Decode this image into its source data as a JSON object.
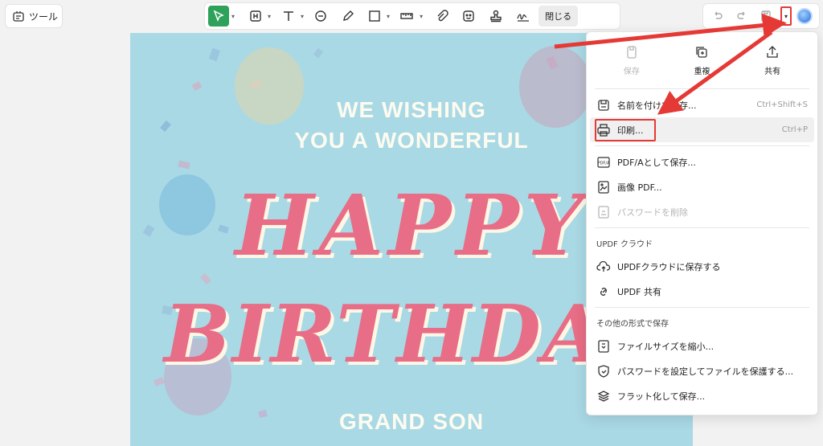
{
  "left": {
    "tools_label": "ツール"
  },
  "toolbar": {
    "close_label": "閉じる"
  },
  "document": {
    "line1": "WE WISHING",
    "line2": "YOU A WONDERFUL",
    "line3": "HAPPY",
    "line4": "BIRTHDAY",
    "line5": "GRAND SON"
  },
  "menu": {
    "top": [
      {
        "label": "保存",
        "icon": "save-icon",
        "disabled": true
      },
      {
        "label": "重複",
        "icon": "duplicate-icon",
        "disabled": false
      },
      {
        "label": "共有",
        "icon": "share-icon",
        "disabled": false
      }
    ],
    "items": [
      {
        "label": "名前を付けて保存...",
        "shortcut": "Ctrl+Shift+S",
        "icon": "save-as-icon"
      },
      {
        "label": "印刷...",
        "shortcut": "Ctrl+P",
        "icon": "printer-icon"
      },
      {
        "label": "PDF/Aとして保存...",
        "icon": "pdfa-icon"
      },
      {
        "label": "画像 PDF...",
        "icon": "image-pdf-icon"
      },
      {
        "label": "パスワードを削除",
        "icon": "remove-password-icon",
        "disabled": true
      }
    ],
    "cloud_section": "UPDF クラウド",
    "cloud_items": [
      {
        "label": "UPDFクラウドに保存する",
        "icon": "cloud-upload-icon"
      },
      {
        "label": "UPDF 共有",
        "icon": "link-icon"
      }
    ],
    "other_section": "その他の形式で保存",
    "other_items": [
      {
        "label": "ファイルサイズを縮小...",
        "icon": "compress-icon"
      },
      {
        "label": "パスワードを設定してファイルを保護する...",
        "icon": "protect-icon"
      },
      {
        "label": "フラット化して保存...",
        "icon": "flatten-icon"
      }
    ]
  },
  "colors": {
    "select_tool": "#2ea15a",
    "highlight": "#e53935",
    "card_bg": "#a9d9e5",
    "birthday_text": "#e86d86"
  }
}
